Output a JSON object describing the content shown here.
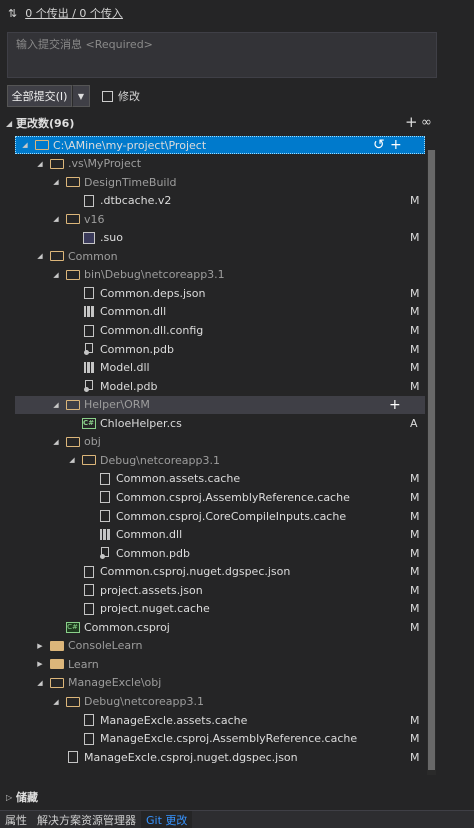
{
  "sync": {
    "arrows_icon": "⇅",
    "text": "0 个传出 / 0 个传入"
  },
  "commit_message": {
    "placeholder": "输入提交消息 <Required>"
  },
  "commit": {
    "button_label": "全部提交(I)",
    "dropdown": "▼",
    "amend_label": "修改"
  },
  "changes": {
    "title": "更改数(96)",
    "plus": "+",
    "more": "∞"
  },
  "tree": [
    {
      "label": "C:\\AMine\\my-project\\Project",
      "depth": 0,
      "kind": "folder",
      "expanded": true,
      "status": "",
      "selected": true
    },
    {
      "label": ".vs\\MyProject",
      "depth": 1,
      "kind": "folder",
      "expanded": true,
      "status": ""
    },
    {
      "label": "DesignTimeBuild",
      "depth": 2,
      "kind": "folder",
      "expanded": true,
      "status": ""
    },
    {
      "label": ".dtbcache.v2",
      "depth": 3,
      "kind": "file",
      "status": "M"
    },
    {
      "label": "v16",
      "depth": 2,
      "kind": "folder",
      "expanded": true,
      "status": ""
    },
    {
      "label": ".suo",
      "depth": 3,
      "kind": "suo",
      "status": "M"
    },
    {
      "label": "Common",
      "depth": 1,
      "kind": "folder",
      "expanded": true,
      "status": ""
    },
    {
      "label": "bin\\Debug\\netcoreapp3.1",
      "depth": 2,
      "kind": "folder",
      "expanded": true,
      "status": ""
    },
    {
      "label": "Common.deps.json",
      "depth": 3,
      "kind": "file",
      "status": "M"
    },
    {
      "label": "Common.dll",
      "depth": 3,
      "kind": "dll",
      "status": "M"
    },
    {
      "label": "Common.dll.config",
      "depth": 3,
      "kind": "file",
      "status": "M"
    },
    {
      "label": "Common.pdb",
      "depth": 3,
      "kind": "pdb",
      "status": "M"
    },
    {
      "label": "Model.dll",
      "depth": 3,
      "kind": "dll",
      "status": "M"
    },
    {
      "label": "Model.pdb",
      "depth": 3,
      "kind": "pdb",
      "status": "M"
    },
    {
      "label": "Helper\\ORM",
      "depth": 2,
      "kind": "folder",
      "expanded": true,
      "status": "",
      "hover": true
    },
    {
      "label": "ChloeHelper.cs",
      "depth": 3,
      "kind": "cs",
      "status": "A"
    },
    {
      "label": "obj",
      "depth": 2,
      "kind": "folder",
      "expanded": true,
      "status": ""
    },
    {
      "label": "Debug\\netcoreapp3.1",
      "depth": 3,
      "kind": "folder",
      "expanded": true,
      "status": ""
    },
    {
      "label": "Common.assets.cache",
      "depth": 4,
      "kind": "file",
      "status": "M"
    },
    {
      "label": "Common.csproj.AssemblyReference.cache",
      "depth": 4,
      "kind": "file",
      "status": "M"
    },
    {
      "label": "Common.csproj.CoreCompileInputs.cache",
      "depth": 4,
      "kind": "file",
      "status": "M"
    },
    {
      "label": "Common.dll",
      "depth": 4,
      "kind": "dll",
      "status": "M"
    },
    {
      "label": "Common.pdb",
      "depth": 4,
      "kind": "pdb",
      "status": "M"
    },
    {
      "label": "Common.csproj.nuget.dgspec.json",
      "depth": 3,
      "kind": "file",
      "status": "M"
    },
    {
      "label": "project.assets.json",
      "depth": 3,
      "kind": "file",
      "status": "M"
    },
    {
      "label": "project.nuget.cache",
      "depth": 3,
      "kind": "file",
      "status": "M"
    },
    {
      "label": "Common.csproj",
      "depth": 2,
      "kind": "proj",
      "status": "M"
    },
    {
      "label": "ConsoleLearn",
      "depth": 1,
      "kind": "folder",
      "expanded": false,
      "status": ""
    },
    {
      "label": "Learn",
      "depth": 1,
      "kind": "folder",
      "expanded": false,
      "status": ""
    },
    {
      "label": "ManageExcle\\obj",
      "depth": 1,
      "kind": "folder",
      "expanded": true,
      "status": ""
    },
    {
      "label": "Debug\\netcoreapp3.1",
      "depth": 2,
      "kind": "folder",
      "expanded": true,
      "status": ""
    },
    {
      "label": "ManageExcle.assets.cache",
      "depth": 3,
      "kind": "file",
      "status": "M"
    },
    {
      "label": "ManageExcle.csproj.AssemblyReference.cache",
      "depth": 3,
      "kind": "file",
      "status": "M"
    },
    {
      "label": "ManageExcle.csproj.nuget.dgspec.json",
      "depth": 2,
      "kind": "file",
      "status": "M"
    }
  ],
  "stashes": {
    "title": "储藏"
  },
  "tabs": [
    "属性",
    "解决方案资源管理器",
    "Git 更改"
  ],
  "active_tab": 2,
  "colors": {
    "accent": "#007acc",
    "background": "#252526",
    "folder": "#dcb67a"
  }
}
